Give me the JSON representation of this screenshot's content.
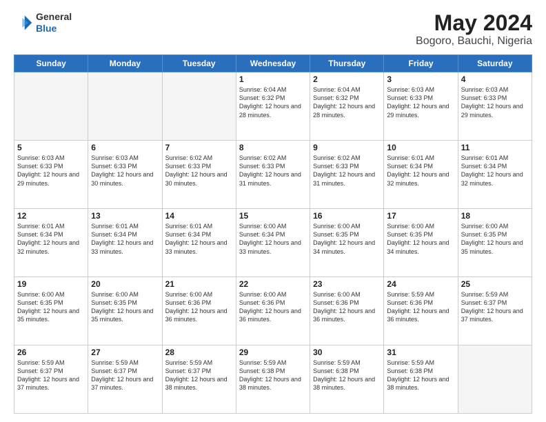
{
  "header": {
    "logo": {
      "line1": "General",
      "line2": "Blue"
    },
    "title": "May 2024",
    "subtitle": "Bogoro, Bauchi, Nigeria"
  },
  "weekdays": [
    "Sunday",
    "Monday",
    "Tuesday",
    "Wednesday",
    "Thursday",
    "Friday",
    "Saturday"
  ],
  "weeks": [
    [
      {
        "day": "",
        "sunrise": "",
        "sunset": "",
        "daylight": "",
        "empty": true
      },
      {
        "day": "",
        "sunrise": "",
        "sunset": "",
        "daylight": "",
        "empty": true
      },
      {
        "day": "",
        "sunrise": "",
        "sunset": "",
        "daylight": "",
        "empty": true
      },
      {
        "day": "1",
        "sunrise": "Sunrise: 6:04 AM",
        "sunset": "Sunset: 6:32 PM",
        "daylight": "Daylight: 12 hours and 28 minutes."
      },
      {
        "day": "2",
        "sunrise": "Sunrise: 6:04 AM",
        "sunset": "Sunset: 6:32 PM",
        "daylight": "Daylight: 12 hours and 28 minutes."
      },
      {
        "day": "3",
        "sunrise": "Sunrise: 6:03 AM",
        "sunset": "Sunset: 6:33 PM",
        "daylight": "Daylight: 12 hours and 29 minutes."
      },
      {
        "day": "4",
        "sunrise": "Sunrise: 6:03 AM",
        "sunset": "Sunset: 6:33 PM",
        "daylight": "Daylight: 12 hours and 29 minutes."
      }
    ],
    [
      {
        "day": "5",
        "sunrise": "Sunrise: 6:03 AM",
        "sunset": "Sunset: 6:33 PM",
        "daylight": "Daylight: 12 hours and 29 minutes."
      },
      {
        "day": "6",
        "sunrise": "Sunrise: 6:03 AM",
        "sunset": "Sunset: 6:33 PM",
        "daylight": "Daylight: 12 hours and 30 minutes."
      },
      {
        "day": "7",
        "sunrise": "Sunrise: 6:02 AM",
        "sunset": "Sunset: 6:33 PM",
        "daylight": "Daylight: 12 hours and 30 minutes."
      },
      {
        "day": "8",
        "sunrise": "Sunrise: 6:02 AM",
        "sunset": "Sunset: 6:33 PM",
        "daylight": "Daylight: 12 hours and 31 minutes."
      },
      {
        "day": "9",
        "sunrise": "Sunrise: 6:02 AM",
        "sunset": "Sunset: 6:33 PM",
        "daylight": "Daylight: 12 hours and 31 minutes."
      },
      {
        "day": "10",
        "sunrise": "Sunrise: 6:01 AM",
        "sunset": "Sunset: 6:34 PM",
        "daylight": "Daylight: 12 hours and 32 minutes."
      },
      {
        "day": "11",
        "sunrise": "Sunrise: 6:01 AM",
        "sunset": "Sunset: 6:34 PM",
        "daylight": "Daylight: 12 hours and 32 minutes."
      }
    ],
    [
      {
        "day": "12",
        "sunrise": "Sunrise: 6:01 AM",
        "sunset": "Sunset: 6:34 PM",
        "daylight": "Daylight: 12 hours and 32 minutes."
      },
      {
        "day": "13",
        "sunrise": "Sunrise: 6:01 AM",
        "sunset": "Sunset: 6:34 PM",
        "daylight": "Daylight: 12 hours and 33 minutes."
      },
      {
        "day": "14",
        "sunrise": "Sunrise: 6:01 AM",
        "sunset": "Sunset: 6:34 PM",
        "daylight": "Daylight: 12 hours and 33 minutes."
      },
      {
        "day": "15",
        "sunrise": "Sunrise: 6:00 AM",
        "sunset": "Sunset: 6:34 PM",
        "daylight": "Daylight: 12 hours and 33 minutes."
      },
      {
        "day": "16",
        "sunrise": "Sunrise: 6:00 AM",
        "sunset": "Sunset: 6:35 PM",
        "daylight": "Daylight: 12 hours and 34 minutes."
      },
      {
        "day": "17",
        "sunrise": "Sunrise: 6:00 AM",
        "sunset": "Sunset: 6:35 PM",
        "daylight": "Daylight: 12 hours and 34 minutes."
      },
      {
        "day": "18",
        "sunrise": "Sunrise: 6:00 AM",
        "sunset": "Sunset: 6:35 PM",
        "daylight": "Daylight: 12 hours and 35 minutes."
      }
    ],
    [
      {
        "day": "19",
        "sunrise": "Sunrise: 6:00 AM",
        "sunset": "Sunset: 6:35 PM",
        "daylight": "Daylight: 12 hours and 35 minutes."
      },
      {
        "day": "20",
        "sunrise": "Sunrise: 6:00 AM",
        "sunset": "Sunset: 6:35 PM",
        "daylight": "Daylight: 12 hours and 35 minutes."
      },
      {
        "day": "21",
        "sunrise": "Sunrise: 6:00 AM",
        "sunset": "Sunset: 6:36 PM",
        "daylight": "Daylight: 12 hours and 36 minutes."
      },
      {
        "day": "22",
        "sunrise": "Sunrise: 6:00 AM",
        "sunset": "Sunset: 6:36 PM",
        "daylight": "Daylight: 12 hours and 36 minutes."
      },
      {
        "day": "23",
        "sunrise": "Sunrise: 6:00 AM",
        "sunset": "Sunset: 6:36 PM",
        "daylight": "Daylight: 12 hours and 36 minutes."
      },
      {
        "day": "24",
        "sunrise": "Sunrise: 5:59 AM",
        "sunset": "Sunset: 6:36 PM",
        "daylight": "Daylight: 12 hours and 36 minutes."
      },
      {
        "day": "25",
        "sunrise": "Sunrise: 5:59 AM",
        "sunset": "Sunset: 6:37 PM",
        "daylight": "Daylight: 12 hours and 37 minutes."
      }
    ],
    [
      {
        "day": "26",
        "sunrise": "Sunrise: 5:59 AM",
        "sunset": "Sunset: 6:37 PM",
        "daylight": "Daylight: 12 hours and 37 minutes."
      },
      {
        "day": "27",
        "sunrise": "Sunrise: 5:59 AM",
        "sunset": "Sunset: 6:37 PM",
        "daylight": "Daylight: 12 hours and 37 minutes."
      },
      {
        "day": "28",
        "sunrise": "Sunrise: 5:59 AM",
        "sunset": "Sunset: 6:37 PM",
        "daylight": "Daylight: 12 hours and 38 minutes."
      },
      {
        "day": "29",
        "sunrise": "Sunrise: 5:59 AM",
        "sunset": "Sunset: 6:38 PM",
        "daylight": "Daylight: 12 hours and 38 minutes."
      },
      {
        "day": "30",
        "sunrise": "Sunrise: 5:59 AM",
        "sunset": "Sunset: 6:38 PM",
        "daylight": "Daylight: 12 hours and 38 minutes."
      },
      {
        "day": "31",
        "sunrise": "Sunrise: 5:59 AM",
        "sunset": "Sunset: 6:38 PM",
        "daylight": "Daylight: 12 hours and 38 minutes."
      },
      {
        "day": "",
        "sunrise": "",
        "sunset": "",
        "daylight": "",
        "empty": true
      }
    ]
  ]
}
